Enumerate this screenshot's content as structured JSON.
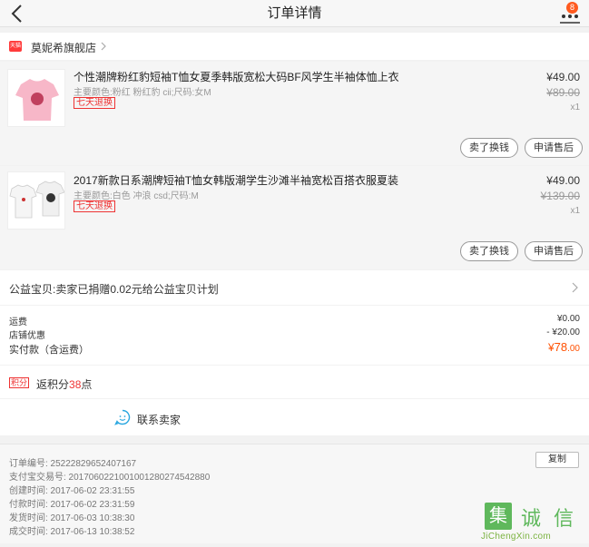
{
  "nav": {
    "title": "订单详情",
    "badge": "8"
  },
  "shop": {
    "name": "莫妮希旗舰店",
    "logo_text": "天猫"
  },
  "items": [
    {
      "title": "个性潮牌粉红豹短袖T恤女夏季韩版宽松大码BF风学生半袖体恤上衣",
      "sku": "主要颜色:粉红 粉红豹 cii;尺码:女M",
      "tag": "七天退换",
      "price": "¥49.00",
      "original_price": "¥89.00",
      "qty": "x1",
      "btn_exchange": "卖了换钱",
      "btn_aftersale": "申请售后"
    },
    {
      "title": "2017新款日系潮牌短袖T恤女韩版潮学生沙滩半袖宽松百搭衣服夏装",
      "sku": "主要颜色:白色 冲浪 csd;尺码:M",
      "tag": "七天退换",
      "price": "¥49.00",
      "original_price": "¥139.00",
      "qty": "x1",
      "btn_exchange": "卖了换钱",
      "btn_aftersale": "申请售后"
    }
  ],
  "charity": {
    "text": "公益宝贝:卖家已捐赠0.02元给公益宝贝计划"
  },
  "fees": {
    "shipping_label": "运费",
    "shipping_value": "¥0.00",
    "discount_label": "店铺优惠",
    "discount_value": "- ¥20.00",
    "paid_label": "实付款（含运费）",
    "paid_prefix": "¥",
    "paid_int": "78",
    "paid_dec": ".00"
  },
  "points": {
    "tag": "积分",
    "prefix": "返积分",
    "value": "38",
    "suffix": "点"
  },
  "contact": {
    "label": "联系卖家"
  },
  "order": {
    "copy_label": "复制",
    "rows": [
      "订单编号:   25222829652407167",
      "支付宝交易号:   2017060221001001280274542880",
      "创建时间:   2017-06-02 23:31:55",
      "付款时间:   2017-06-02 23:31:59",
      "发货时间:   2017-06-03 10:38:30",
      "成交时间:   2017-06-13 10:38:52"
    ]
  },
  "watermark": {
    "c1": "集",
    "c2": "诚",
    "c3": "信",
    "url": "JiChengXin.com"
  },
  "colors": {
    "accent": "#ff5000",
    "tag_red": "#e33",
    "watermark_green": "#5fb85c"
  }
}
